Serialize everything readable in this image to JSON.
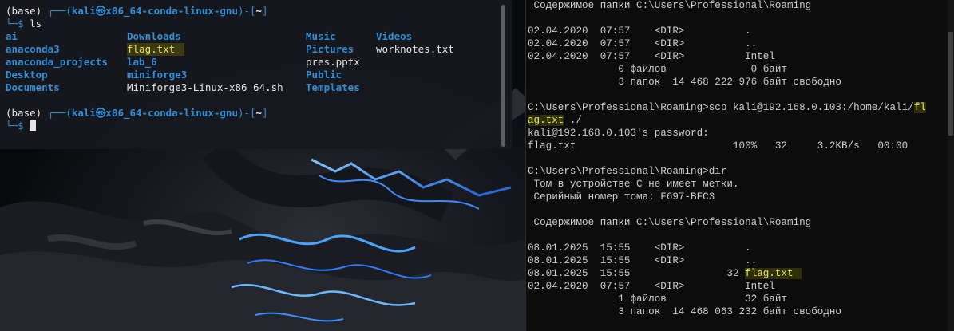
{
  "kali_terminal": {
    "prompts": [
      {
        "env": "(base) ",
        "frame_open": "┌──(",
        "user_host": "kali㉿x86_64-conda-linux-gnu",
        "frame_mid": ")-[",
        "cwd": "~",
        "frame_close": "]",
        "second_line": "└─$ ",
        "command": "ls"
      },
      {
        "env": "(base) ",
        "frame_open": "┌──(",
        "user_host": "kali㉿x86_64-conda-linux-gnu",
        "frame_mid": ")-[",
        "cwd": "~",
        "frame_close": "]",
        "second_line": "└─$ ",
        "command": ""
      }
    ],
    "ls_output": [
      {
        "name": "ai",
        "kind": "dir"
      },
      {
        "name": "anaconda3",
        "kind": "dir"
      },
      {
        "name": "anaconda_projects",
        "kind": "dir"
      },
      {
        "name": "Desktop",
        "kind": "dir"
      },
      {
        "name": "Documents",
        "kind": "dir"
      },
      {
        "name": "Downloads",
        "kind": "dir"
      },
      {
        "name": "flag.txt",
        "kind": "file-highlight"
      },
      {
        "name": "lab_6",
        "kind": "dir"
      },
      {
        "name": "miniforge3",
        "kind": "dir"
      },
      {
        "name": "Miniforge3-Linux-x86_64.sh",
        "kind": "file"
      },
      {
        "name": "Music",
        "kind": "dir"
      },
      {
        "name": "Pictures",
        "kind": "dir"
      },
      {
        "name": "pres.pptx",
        "kind": "file"
      },
      {
        "name": "Public",
        "kind": "dir"
      },
      {
        "name": "Templates",
        "kind": "dir"
      },
      {
        "name": "Videos",
        "kind": "dir"
      },
      {
        "name": "worknotes.txt",
        "kind": "file"
      }
    ]
  },
  "windows_cmd": {
    "lines": [
      {
        "text": " Содержимое папки C:\\Users\\Professional\\Roaming"
      },
      {
        "text": ""
      },
      {
        "text": "02.04.2020  07:57    <DIR>          ."
      },
      {
        "text": "02.04.2020  07:57    <DIR>          .."
      },
      {
        "text": "02.04.2020  07:57    <DIR>          Intel"
      },
      {
        "text": "               0 файлов              0 байт"
      },
      {
        "text": "               3 папок  14 468 222 976 байт свободно"
      },
      {
        "text": ""
      },
      {
        "text": "C:\\Users\\Professional\\Roaming>scp kali@192.168.0.103:/home/kali/",
        "hl": "fl"
      },
      {
        "text": "",
        "hl": "ag.txt",
        "after": " ./"
      },
      {
        "text": "kali@192.168.0.103's password:"
      },
      {
        "text": "flag.txt                          100%   32     3.2KB/s   00:00"
      },
      {
        "text": ""
      },
      {
        "text": "C:\\Users\\Professional\\Roaming>dir"
      },
      {
        "text": " Том в устройстве C не имеет метки."
      },
      {
        "text": " Серийный номер тома: F697-BFC3"
      },
      {
        "text": ""
      },
      {
        "text": " Содержимое папки C:\\Users\\Professional\\Roaming"
      },
      {
        "text": ""
      },
      {
        "text": "08.01.2025  15:55    <DIR>          ."
      },
      {
        "text": "08.01.2025  15:55    <DIR>          .."
      },
      {
        "text": "08.01.2025  15:55                32 ",
        "hl": "flag.txt"
      },
      {
        "text": "02.04.2020  07:57    <DIR>          Intel"
      },
      {
        "text": "               1 файлов             32 байт"
      },
      {
        "text": "               3 папок  14 468 063 232 байт свободно"
      }
    ]
  },
  "colors": {
    "kali_prompt_blue": "#2f8ed6",
    "highlight_yellow": "#f2e64a",
    "cmd_text": "#cccccc",
    "cmd_background": "#0c0c0c"
  }
}
